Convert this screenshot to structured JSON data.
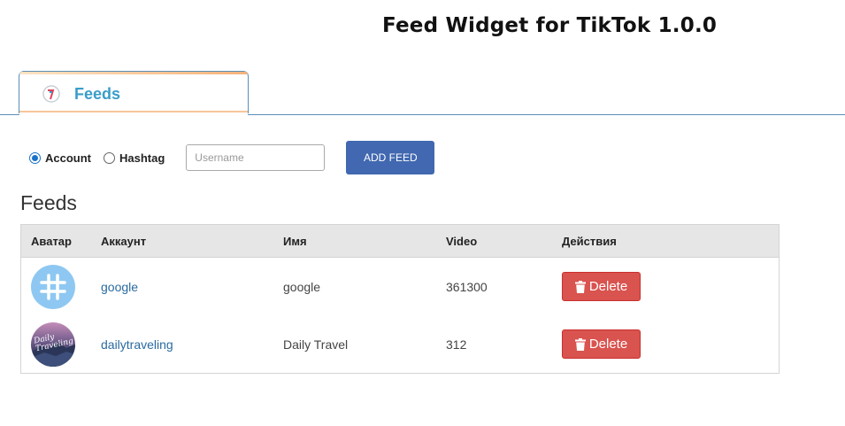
{
  "app_title": "Feed Widget for TikTok 1.0.0",
  "tabs": [
    {
      "label": "Feeds",
      "icon": "tiktok-feed-logo-icon",
      "active": true
    }
  ],
  "controls": {
    "radio_account_label": "Account",
    "radio_hashtag_label": "Hashtag",
    "selected": "Account",
    "username_placeholder": "Username",
    "username_value": "",
    "add_feed_label": "ADD FEED"
  },
  "section_heading": "Feeds",
  "table": {
    "headers": [
      "Аватар",
      "Аккаунт",
      "Имя",
      "Video",
      "Действия"
    ],
    "rows": [
      {
        "avatar": "hashtag-icon",
        "account": "google",
        "name": "google",
        "video": "361300",
        "action_label": "Delete"
      },
      {
        "avatar": "daily-traveling-avatar",
        "account": "dailytraveling",
        "name": "Daily Travel",
        "video": "312",
        "action_label": "Delete"
      }
    ]
  },
  "colors": {
    "tab_label": "#3a9dc8",
    "add_feed_button": "#4168b0",
    "delete_button": "#d9534f",
    "link": "#2a6aa0",
    "table_header_bg": "#e6e6e6"
  }
}
